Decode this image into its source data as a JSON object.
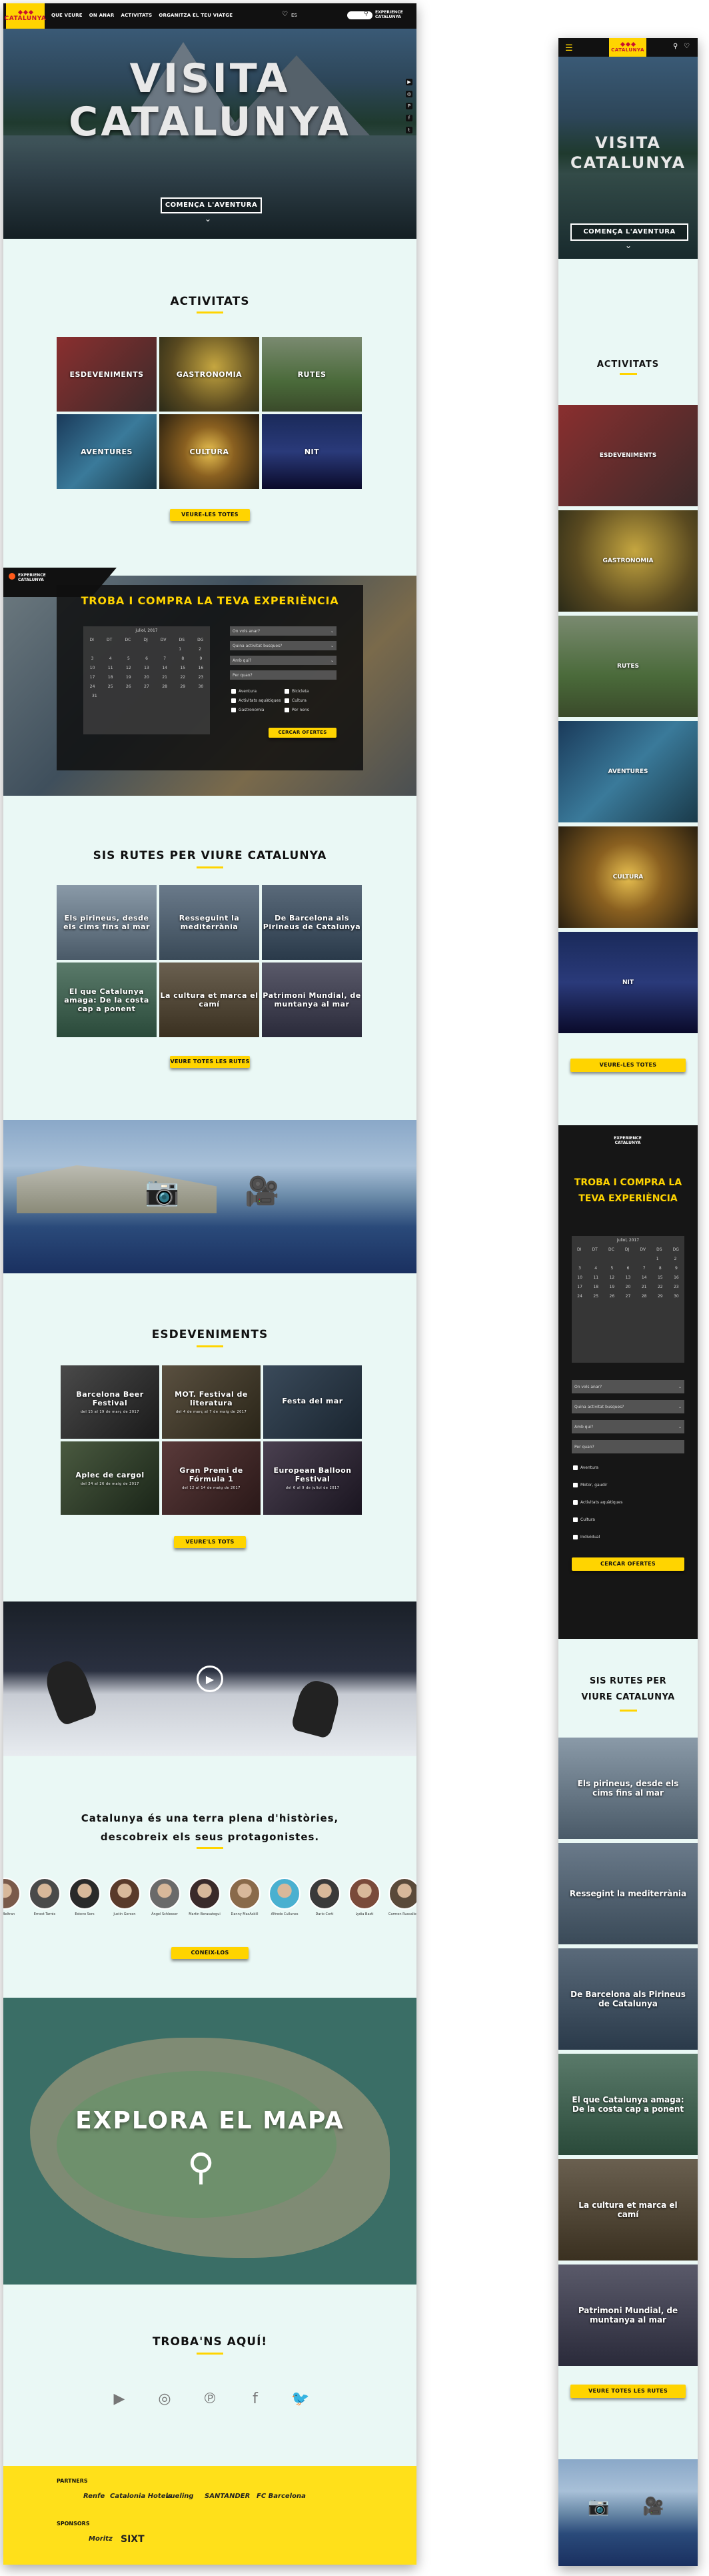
{
  "brand": {
    "name": "CATALUNYA",
    "accent": "#ffd400",
    "red": "#c8102e",
    "dark": "#111111",
    "bg": "#eaf8f5"
  },
  "nav": {
    "links": [
      "QUE VEURE",
      "ON ANAR",
      "ACTIVITATS",
      "ORGANITZA EL TEU VIATGE"
    ],
    "lang": "ES",
    "experience_logo": "EXPERIENCE CATALUNYA"
  },
  "hero": {
    "title_line1": "VISITA",
    "title_line2": "CATALUNYA",
    "cta": "COMENÇA L'AVENTURA"
  },
  "activitats": {
    "title": "ACTIVITATS",
    "tiles": [
      "ESDEVENIMENTS",
      "GASTRONOMIA",
      "RUTES",
      "AVENTURES",
      "CULTURA",
      "NIT"
    ],
    "button": "VEURE-LES TOTES"
  },
  "booking": {
    "title": "TROBA I COMPRA LA TEVA EXPERIÈNCIA",
    "calendar_month": "juliol, 2017",
    "weekdays": [
      "DI",
      "DT",
      "DC",
      "DJ",
      "DV",
      "DS",
      "DG"
    ],
    "cal_rows": [
      [
        "",
        "",
        "",
        "",
        "",
        "1",
        "2"
      ],
      [
        "3",
        "4",
        "5",
        "6",
        "7",
        "8",
        "9"
      ],
      [
        "10",
        "11",
        "12",
        "13",
        "14",
        "15",
        "16"
      ],
      [
        "17",
        "18",
        "19",
        "20",
        "21",
        "22",
        "23"
      ],
      [
        "24",
        "25",
        "26",
        "27",
        "28",
        "29",
        "30"
      ],
      [
        "31",
        "",
        "",
        "",
        "",
        "",
        ""
      ]
    ],
    "selects": [
      "On vols anar?",
      "Quina activitat busques?",
      "Amb qui?",
      "Per quan?"
    ],
    "checkboxes": [
      "Aventura",
      "Bicicleta",
      "Activitats aquàtiques",
      "Cultura",
      "Gastronomia",
      "Per nens"
    ],
    "button": "CERCAR OFERTES",
    "experience_logo": "EXPERIENCE CATALUNYA"
  },
  "rutes": {
    "title": "SIS RUTES PER VIURE CATALUNYA",
    "tiles": [
      "Els pirineus, desde els cims fins al mar",
      "Resseguint la mediterrània",
      "De Barcelona als Pirineus de Catalunya",
      "El que Catalunya amaga: De la costa cap a ponent",
      "La cultura et marca el camí",
      "Patrimoni Mundial, de muntanya al mar"
    ],
    "button": "VEURE TOTES LES RUTES"
  },
  "esdeveniments": {
    "title": "ESDEVENIMENTS",
    "tiles": [
      {
        "name": "Barcelona Beer Festival",
        "date": "del 15 al 19 de març de 2017"
      },
      {
        "name": "MOT. Festival de literatura",
        "date": "del 4 de març al 7 de maig de 2017"
      },
      {
        "name": "Festa del mar",
        "date": ""
      },
      {
        "name": "Aplec de cargol",
        "date": "del 24 al 26 de maig de 2017"
      },
      {
        "name": "Gran Premi de Fórmula 1",
        "date": "del 12 al 14 de maig de 2017"
      },
      {
        "name": "European Balloon Festival",
        "date": "del 6 al 9 de juliol de 2017"
      }
    ],
    "button": "VEURE'LS TOTS"
  },
  "protagonistes": {
    "title_line1": "Catalunya és una terra plena d'històries,",
    "title_line2": "descobreix els seus protagonistes.",
    "people": [
      "Joan Beltran",
      "Ernest Tarrés",
      "Esteve Sors",
      "Justin Gerson",
      "Àngel Schlesser",
      "Martin Berasategui",
      "Danny MacAskill",
      "Alfredo Cullunes",
      "Dario Corti",
      "Lydia Basti",
      "Carmen Ruscalleda"
    ],
    "button": "CONEIX-LOS"
  },
  "map": {
    "title": "EXPLORA EL MAPA"
  },
  "social": {
    "title": "TROBA'NS AQUÍ!",
    "icons": [
      "youtube-icon",
      "instagram-icon",
      "pinterest-icon",
      "facebook-icon",
      "twitter-icon"
    ]
  },
  "footer": {
    "partners_label": "PARTNERS",
    "partners": [
      "Renfe",
      "Catalonia Hotels",
      "vueling",
      "SANTANDER",
      "FC Barcelona"
    ],
    "sponsors_label": "SPONSORS",
    "sponsors": [
      "Moritz",
      "SIXT"
    ]
  },
  "mobile": {
    "tiles": [
      "ESDEVENIMENTS",
      "GASTRONOMIA",
      "RUTES",
      "AVENTURES",
      "CULTURA",
      "NIT"
    ],
    "booking_title": "TROBA I COMPRA LA TEVA EXPERIÈNCIA",
    "selects": [
      "On vols anar?",
      "Quina activitat busques?",
      "Amb qui?",
      "Per quan?"
    ],
    "checkboxes": [
      "Aventura",
      "Motor, gaudir",
      "Activitats aquàtiques",
      "Cultura",
      "Individual"
    ],
    "booking_button": "CERCAR OFERTES",
    "rutes_title_line1": "SIS RUTES PER",
    "rutes_title_line2": "VIURE CATALUNYA",
    "rutes_tiles": [
      "Els pirineus, desde els cims fins al mar",
      "Ressegint la mediterrània",
      "De Barcelona als Pirineus de Catalunya",
      "El que Catalunya amaga: De la costa cap a ponent",
      "La cultura et marca el camí",
      "Patrimoni Mundial, de muntanya al mar"
    ],
    "rutes_button": "VEURE TOTES LES RUTES",
    "activitats_button": "VEURE-LES TOTES"
  }
}
